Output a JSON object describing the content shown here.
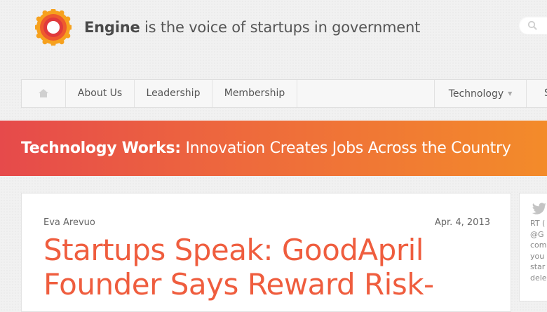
{
  "header": {
    "brand": "Engine",
    "tagline_rest": " is the voice of startups in government",
    "logo_icon": "engine-sunburst-logo",
    "search_icon": "search-icon"
  },
  "nav": {
    "home_icon": "home-icon",
    "items": [
      "About Us",
      "Leadership",
      "Membership"
    ],
    "dropdown_label": "Technology",
    "dropdown_caret": "▼",
    "overflow_label": "S"
  },
  "banner": {
    "strong": "Technology Works:",
    "rest": " Innovation Creates Jobs Across the Country"
  },
  "article": {
    "author": "Eva Arevuo",
    "date": "Apr. 4, 2013",
    "headline": "Startups Speak: GoodApril Founder Says Reward Risk-"
  },
  "twitter": {
    "icon": "twitter-bird-icon",
    "lines": [
      "RT (",
      "@G",
      "com",
      "you",
      "star",
      "dele"
    ]
  },
  "colors": {
    "accent": "#ef5d3e",
    "banner_start": "#e64a4b",
    "banner_end": "#f38b2a",
    "background": "#f1f1f1"
  }
}
